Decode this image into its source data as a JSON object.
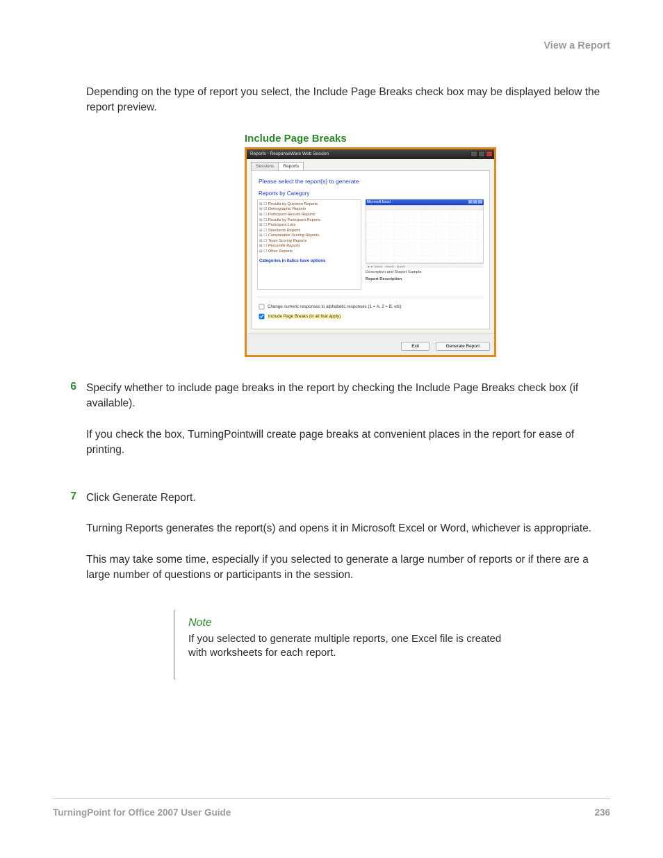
{
  "header": {
    "section_link": "View a Report"
  },
  "intro": "Depending on the type of report you select, the Include Page Breaks check box may be displayed below the report preview.",
  "figure": {
    "caption": "Include Page Breaks",
    "titlebar": "Reports - ResponseWare Web Session",
    "tabs": {
      "sessions": "Sessions",
      "reports": "Reports"
    },
    "prompt": "Please select the report(s) to generate",
    "category_heading": "Reports by Category",
    "tree": [
      "Results by Question Reports",
      "Demographic Reports",
      "Participant Results Reports",
      "Results by Participant Reports",
      "Participant Lists",
      "Standards Reports",
      "Comparative Scoring Reports",
      "Team Scoring Reports",
      "Percentile Reports",
      "Other Reports"
    ],
    "tree_note": "Categories in italics have options",
    "preview": {
      "desc_heading": "Description and Report Sample",
      "desc_sub": "Report Description"
    },
    "checkbox1": {
      "label": "Change numeric responses to alphabetic responses (1 = A, 2 = B, etc)",
      "checked": false
    },
    "checkbox2": {
      "label": "Include Page Breaks (in all that apply)",
      "checked": true
    },
    "buttons": {
      "exit": "Exit",
      "generate": "Generate Report"
    }
  },
  "steps": [
    {
      "num": "6",
      "paras": [
        "Specify whether to include page breaks in the report by checking the Include Page Breaks check box (if available).",
        "If you check the box, TurningPointwill create page breaks at convenient places in the report for ease of printing."
      ]
    },
    {
      "num": "7",
      "paras": [
        "Click Generate Report.",
        "Turning Reports generates the report(s) and opens it in Microsoft Excel or Word, whichever is appropriate.",
        "This may take some time, especially if you selected to generate a large number of reports or if there are a large number of questions or participants in the session."
      ]
    }
  ],
  "note": {
    "heading": "Note",
    "text": "If you selected to generate multiple reports, one Excel file is created with worksheets for each report."
  },
  "footer": {
    "left": "TurningPoint for Office 2007 User Guide",
    "right": "236"
  }
}
